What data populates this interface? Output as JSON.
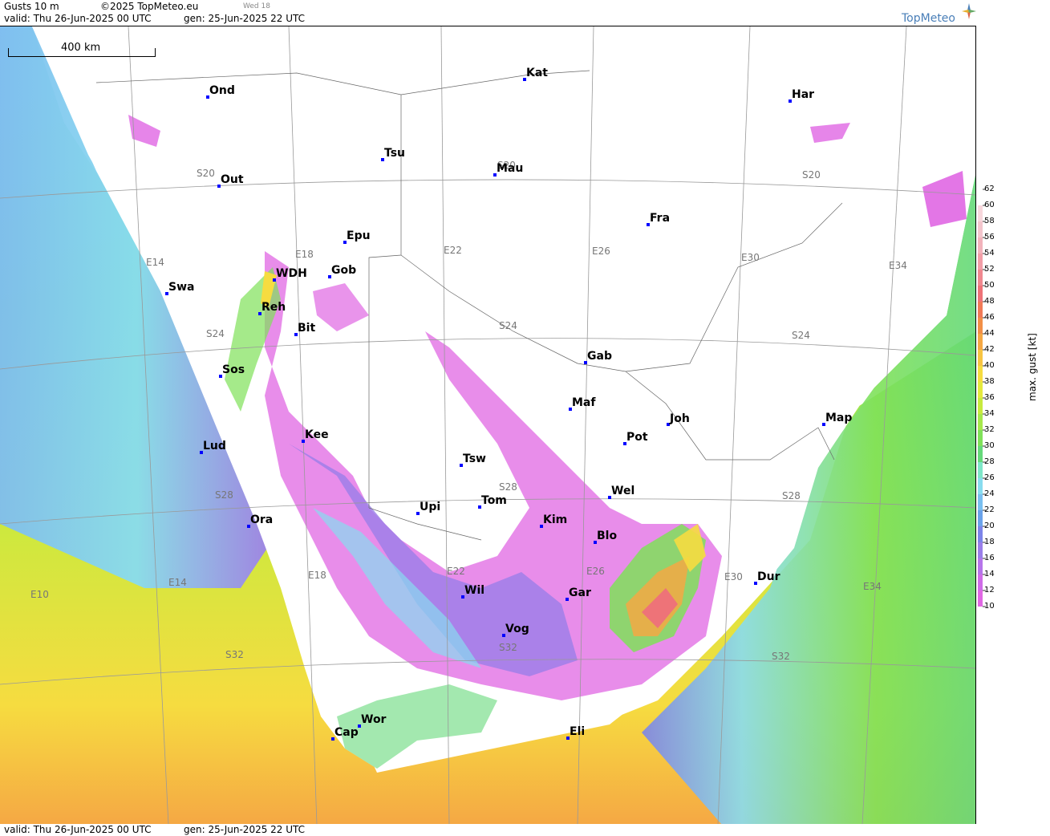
{
  "header": {
    "title": "Gusts 10 m",
    "copyright": "©2025 TopMeteo.eu",
    "day_tag": "Wed 18",
    "valid": "valid:  Thu  26-Jun-2025  00 UTC",
    "gen": "gen:  25-Jun-2025 22 UTC",
    "logo": "TopMeteo"
  },
  "footer": {
    "valid": "valid:  Thu  26-Jun-2025  00 UTC",
    "gen": "gen:  25-Jun-2025 22 UTC"
  },
  "scale_bar": "400 km",
  "legend": {
    "title": "max. gust  [kt]",
    "ticks": [
      "62",
      "60",
      "58",
      "56",
      "54",
      "52",
      "50",
      "48",
      "46",
      "44",
      "42",
      "40",
      "38",
      "36",
      "34",
      "32",
      "30",
      "28",
      "26",
      "24",
      "22",
      "20",
      "18",
      "16",
      "14",
      "12",
      "10"
    ],
    "colors": [
      "#ffffff",
      "#f7d7dc",
      "#f3c5cc",
      "#f2b3bb",
      "#f29ea7",
      "#f0888f",
      "#ee7378",
      "#f17a57",
      "#f28f47",
      "#f5a844",
      "#f7c442",
      "#f6dc40",
      "#e4e93e",
      "#c8ea3e",
      "#a6e84c",
      "#7fe159",
      "#65d97a",
      "#7ee6c8",
      "#88dcef",
      "#79bff0",
      "#6aa2ea",
      "#7c84e9",
      "#9a7ee9",
      "#b675ea",
      "#cf6ce8",
      "#e067e3",
      "#ffffff"
    ]
  },
  "grid_labels": [
    "S20",
    "S20",
    "S20",
    "S24",
    "S24",
    "S24",
    "S28",
    "S28",
    "S28",
    "S32",
    "S32",
    "S32",
    "E10",
    "E14",
    "E14",
    "E18",
    "E18",
    "E22",
    "E22",
    "E26",
    "E26",
    "E30",
    "E30",
    "E34",
    "E34"
  ],
  "cities": [
    "Ond",
    "Kat",
    "Har",
    "Tsu",
    "Out",
    "Mau",
    "Fra",
    "Epu",
    "Gob",
    "WDH",
    "Swa",
    "Reh",
    "Bit",
    "Gab",
    "Sos",
    "Maf",
    "Joh",
    "Kee",
    "Pot",
    "Map",
    "Lud",
    "Tsw",
    "Wel",
    "Upi",
    "Tom",
    "Ora",
    "Kim",
    "Blo",
    "Wil",
    "Gar",
    "Dur",
    "Vog",
    "Wor",
    "Cap",
    "Eli"
  ]
}
